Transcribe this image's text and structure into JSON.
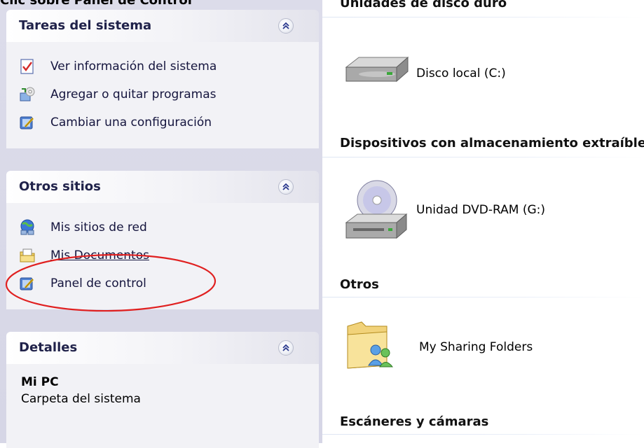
{
  "caption": "Clic sobre Panel de Control",
  "sidebar": {
    "system_tasks": {
      "title": "Tareas del sistema",
      "items": [
        {
          "label": "Ver información del sistema",
          "icon": "system-info-icon"
        },
        {
          "label": "Agregar o quitar programas",
          "icon": "add-remove-programs-icon"
        },
        {
          "label": "Cambiar una configuración",
          "icon": "control-panel-icon"
        }
      ]
    },
    "other_places": {
      "title": "Otros sitios",
      "items": [
        {
          "label": "Mis sitios de red",
          "icon": "network-places-icon"
        },
        {
          "label": "Mis Documentos",
          "icon": "my-documents-icon"
        },
        {
          "label": "Panel de control",
          "icon": "control-panel-icon"
        }
      ]
    },
    "details": {
      "title": "Detalles",
      "name": "Mi PC",
      "description": "Carpeta del sistema"
    }
  },
  "content": {
    "groups": [
      {
        "header": "Unidades de disco duro",
        "items": [
          {
            "label": "Disco local (C:)",
            "icon": "hard-drive-icon"
          }
        ]
      },
      {
        "header": "Dispositivos con almacenamiento extraíble",
        "items": [
          {
            "label": "Unidad DVD-RAM (G:)",
            "icon": "dvd-drive-icon"
          }
        ]
      },
      {
        "header": "Otros",
        "items": [
          {
            "label": "My Sharing Folders",
            "icon": "sharing-folder-icon"
          }
        ]
      },
      {
        "header": "Escáneres y cámaras",
        "items": []
      }
    ]
  },
  "colors": {
    "pane_background": "#d6d6e6",
    "panel_body": "#f2f2f6",
    "link_text": "#15153e",
    "annotation_red": "#e02020"
  }
}
